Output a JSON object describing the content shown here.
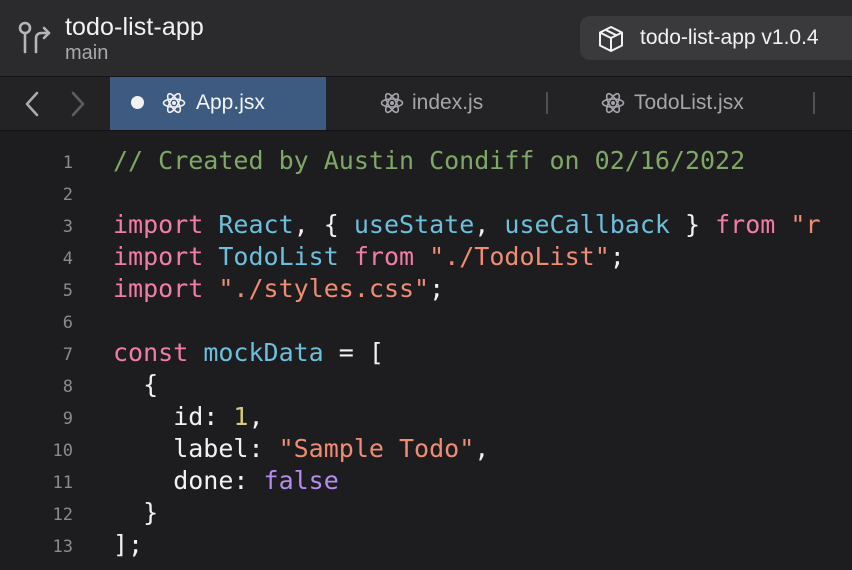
{
  "header": {
    "repo_name": "todo-list-app",
    "branch": "main",
    "package_label": "todo-list-app v1.0.4"
  },
  "tabs": [
    {
      "label": "App.jsx",
      "active": true,
      "modified": true,
      "icon": "react-icon"
    },
    {
      "label": "index.js",
      "active": false,
      "modified": false,
      "icon": "react-icon"
    },
    {
      "label": "TodoList.jsx",
      "active": false,
      "modified": false,
      "icon": "react-icon"
    }
  ],
  "editor": {
    "lines": [
      {
        "n": "1",
        "tokens": [
          {
            "t": "comment",
            "v": "// Created by Austin Condiff on 02/16/2022"
          }
        ]
      },
      {
        "n": "2",
        "tokens": []
      },
      {
        "n": "3",
        "tokens": [
          {
            "t": "keyword",
            "v": "import"
          },
          {
            "t": "text",
            "v": " "
          },
          {
            "t": "ident",
            "v": "React"
          },
          {
            "t": "text",
            "v": ", { "
          },
          {
            "t": "ident",
            "v": "useState"
          },
          {
            "t": "text",
            "v": ", "
          },
          {
            "t": "ident",
            "v": "useCallback"
          },
          {
            "t": "text",
            "v": " } "
          },
          {
            "t": "keyword",
            "v": "from"
          },
          {
            "t": "text",
            "v": " "
          },
          {
            "t": "string",
            "v": "\"r"
          }
        ]
      },
      {
        "n": "4",
        "tokens": [
          {
            "t": "keyword",
            "v": "import"
          },
          {
            "t": "text",
            "v": " "
          },
          {
            "t": "ident",
            "v": "TodoList"
          },
          {
            "t": "text",
            "v": " "
          },
          {
            "t": "keyword",
            "v": "from"
          },
          {
            "t": "text",
            "v": " "
          },
          {
            "t": "string",
            "v": "\"./TodoList\""
          },
          {
            "t": "text",
            "v": ";"
          }
        ]
      },
      {
        "n": "5",
        "tokens": [
          {
            "t": "keyword",
            "v": "import"
          },
          {
            "t": "text",
            "v": " "
          },
          {
            "t": "string",
            "v": "\"./styles.css\""
          },
          {
            "t": "text",
            "v": ";"
          }
        ]
      },
      {
        "n": "6",
        "tokens": []
      },
      {
        "n": "7",
        "tokens": [
          {
            "t": "keyword",
            "v": "const"
          },
          {
            "t": "text",
            "v": " "
          },
          {
            "t": "ident",
            "v": "mockData"
          },
          {
            "t": "text",
            "v": " = ["
          }
        ]
      },
      {
        "n": "8",
        "tokens": [
          {
            "t": "text",
            "v": "  {"
          }
        ]
      },
      {
        "n": "9",
        "tokens": [
          {
            "t": "text",
            "v": "    id: "
          },
          {
            "t": "number",
            "v": "1"
          },
          {
            "t": "text",
            "v": ","
          }
        ]
      },
      {
        "n": "10",
        "tokens": [
          {
            "t": "text",
            "v": "    label: "
          },
          {
            "t": "string",
            "v": "\"Sample Todo\""
          },
          {
            "t": "text",
            "v": ","
          }
        ]
      },
      {
        "n": "11",
        "tokens": [
          {
            "t": "text",
            "v": "    done: "
          },
          {
            "t": "const",
            "v": "false"
          }
        ]
      },
      {
        "n": "12",
        "tokens": [
          {
            "t": "text",
            "v": "  }"
          }
        ]
      },
      {
        "n": "13",
        "tokens": [
          {
            "t": "text",
            "v": "];"
          }
        ]
      }
    ]
  },
  "icons": {
    "branch": "git-branch-icon",
    "package": "package-box-icon",
    "back": "chevron-left-icon",
    "forward": "chevron-right-icon"
  }
}
